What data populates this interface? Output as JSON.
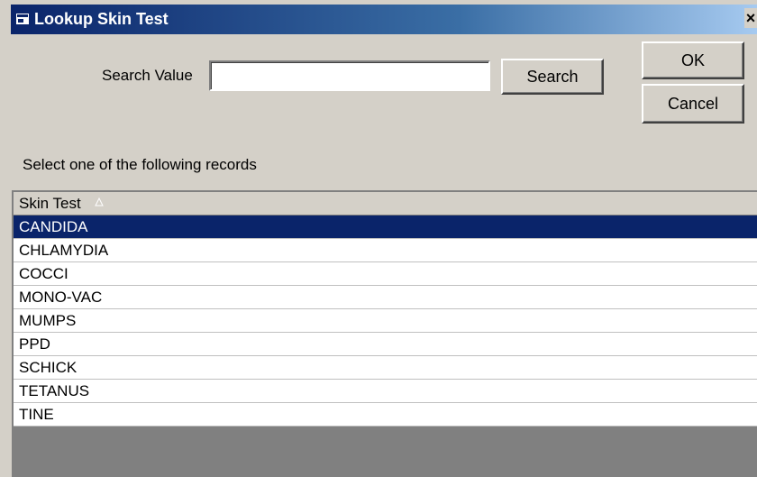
{
  "window": {
    "title": "Lookup Skin Test",
    "close_glyph": "×"
  },
  "search": {
    "label": "Search Value",
    "value": "",
    "placeholder": "",
    "button_label": "Search"
  },
  "buttons": {
    "ok_label": "OK",
    "cancel_label": "Cancel"
  },
  "instruction": "Select one of the following records",
  "grid": {
    "column_header": "Skin Test",
    "sort": "ascending",
    "selected_index": 0,
    "rows": [
      "CANDIDA",
      "CHLAMYDIA",
      "COCCI",
      "MONO-VAC",
      "MUMPS",
      "PPD",
      "SCHICK",
      "TETANUS",
      "TINE"
    ]
  },
  "colors": {
    "title_bar": "#0a246a",
    "selection": "#0a246a",
    "face": "#d4d0c8"
  },
  "icons": {
    "app": "app-window-icon",
    "sort": "sort-ascending-icon"
  }
}
